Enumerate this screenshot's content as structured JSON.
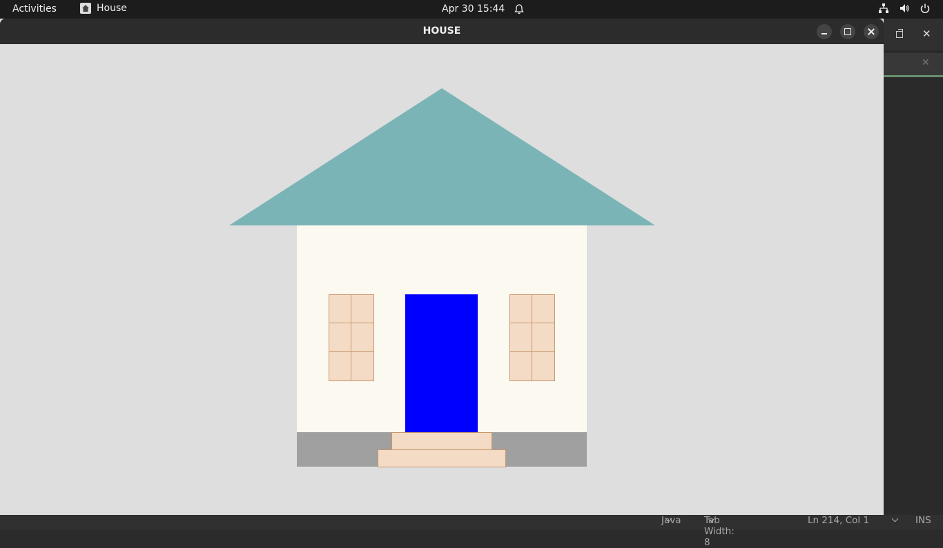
{
  "topbar": {
    "activities": "Activities",
    "app_name": "House",
    "datetime": "Apr 30  15:44",
    "icons": [
      "network-icon",
      "volume-icon",
      "power-icon"
    ]
  },
  "window": {
    "title": "HOUSE"
  },
  "statusbar": {
    "language": "Java",
    "tab_width": "Tab Width: 8",
    "position": "Ln 214, Col 1",
    "mode": "INS"
  },
  "colors": {
    "roof": "#7bb4b6",
    "wall": "#fcf9f1",
    "door": "#0000ff",
    "window_fill": "#f3dbc5",
    "trim": "#c8956a",
    "foundation": "#a0a0a0",
    "steps": "#f3dbc5",
    "background": "#dedede"
  }
}
